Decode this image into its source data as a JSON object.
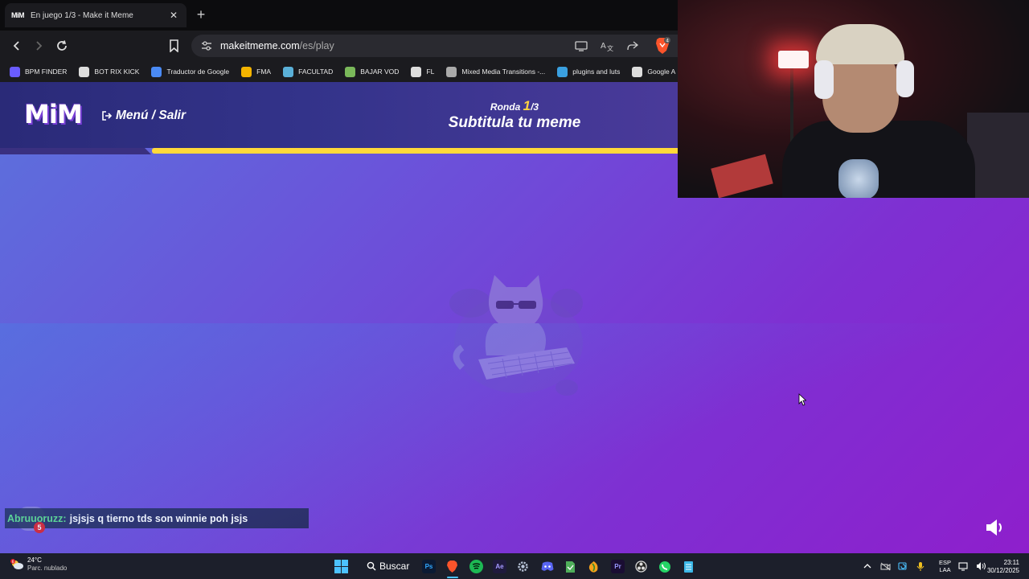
{
  "browser": {
    "tab": {
      "favicon": "MiM",
      "title": "En juego 1/3 - Make it Meme"
    },
    "address": {
      "host": "makeitmeme.com",
      "path": "/es/play"
    },
    "brave_badge": "4",
    "bookmarks": [
      {
        "label": "BPM FINDER",
        "icon": "bpm-icon",
        "color": "#6a5cff"
      },
      {
        "label": "BOT RIX KICK",
        "icon": "bot-icon",
        "color": "#dddddd"
      },
      {
        "label": "Traductor de Google",
        "icon": "translate-icon",
        "color": "#4a8af4"
      },
      {
        "label": "FMA",
        "icon": "drive-icon",
        "color": "#f4b400"
      },
      {
        "label": "FACULTAD",
        "icon": "folder-icon",
        "color": "#5ab0d8"
      },
      {
        "label": "BAJAR VOD",
        "icon": "vod-icon",
        "color": "#7ab85a"
      },
      {
        "label": "FL",
        "icon": "fl-icon",
        "color": "#dddddd"
      },
      {
        "label": "Mixed Media Transitions -...",
        "icon": "mm-icon",
        "color": "#aaaaaa"
      },
      {
        "label": "plugins and luts",
        "icon": "plugins-icon",
        "color": "#3aa0e0"
      },
      {
        "label": "Google A",
        "icon": "external-icon",
        "color": "#dddddd"
      }
    ]
  },
  "game": {
    "logo": "MiM",
    "menu_exit": "Menú / Salir",
    "round_label": "Ronda",
    "round_current": "1",
    "round_total": "/3",
    "phase": "Subtitula tu meme",
    "progress_fraction": 1.0,
    "colors": {
      "accent": "#ffd93a",
      "bar": "#2a2a78"
    }
  },
  "chat": {
    "user": "Abruuoruzz:",
    "message": "jsjsjs q tierno tds son winnie poh jsjs",
    "badge": "5"
  },
  "taskbar": {
    "weather_temp": "24°C",
    "weather_desc": "Parc. nublado",
    "weather_badge": "6",
    "search_label": "Buscar",
    "apps": [
      "photoshop-icon",
      "brave-icon",
      "spotify-icon",
      "after-effects-icon",
      "settings-icon",
      "discord-icon",
      "file-icon",
      "fl-studio-icon",
      "premiere-icon",
      "obs-icon",
      "whatsapp-icon",
      "notepad-icon"
    ],
    "lang_1": "ESP",
    "lang_2": "LAA",
    "time": "23:11",
    "date": "30/12/2025"
  }
}
